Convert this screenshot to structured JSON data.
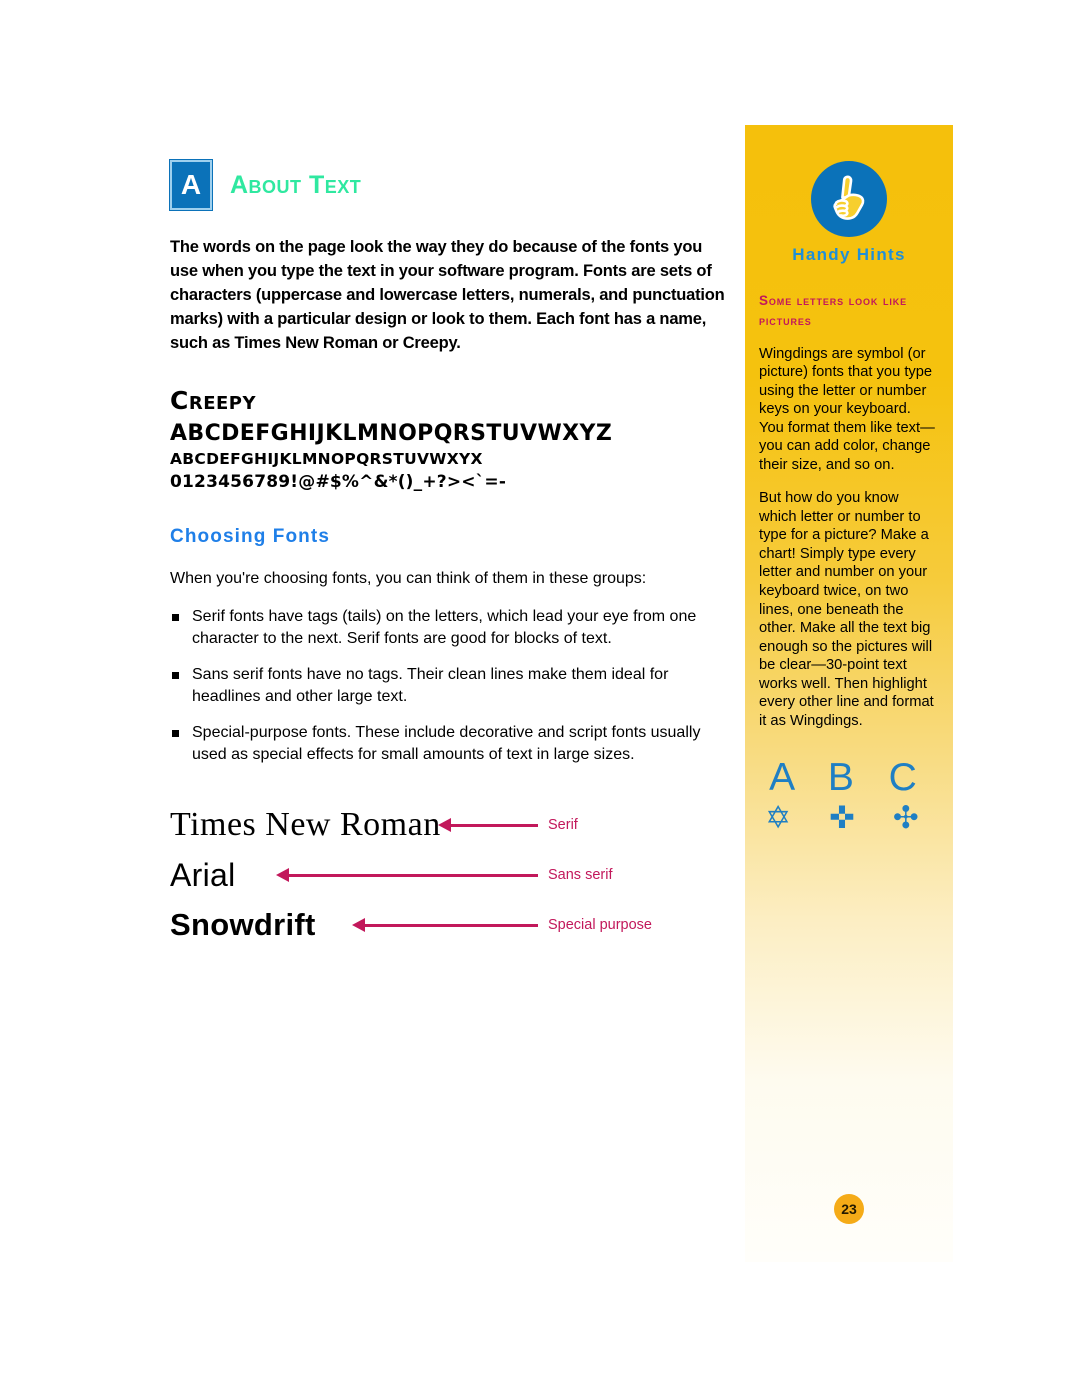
{
  "colors": {
    "badge_blue": "#0b72b9",
    "title_green": "#2fe8a0",
    "subheading_blue": "#1f7fe8",
    "arrow_crimson": "#c2185b",
    "sidebar_yellow": "#f5c00c",
    "hint_title_blue": "#1f8fd8",
    "wingdings_blue": "#1f7fc4",
    "page_badge_orange": "#f5ab17"
  },
  "main": {
    "badge_letter": "A",
    "section_title": "About Text",
    "intro": "The words on the page look the way they do because of the fonts you use when you type the text in your software program. Fonts are sets of characters (uppercase and lowercase letters, numerals, and punctuation marks) with a particular design or look to them. Each font has a name, such as Times New Roman or Creepy.",
    "specimen": {
      "name": "Creepy",
      "uppercase": "ABCDEFGHIJKLMNOPQRSTUVWXYZ",
      "smallcaps": "ABCDEFGHIJKLMNOPQRSTUVWXYX",
      "digits": "0123456789!@#$%^&*()_+?><`=-"
    },
    "subheading": "Choosing Fonts",
    "choosing_intro": "When you're choosing fonts, you can think of them in these groups:",
    "bullets": [
      "Serif fonts have tags (tails) on the letters, which lead your eye from one character to the next. Serif fonts are good for blocks of text.",
      "Sans serif fonts have no tags. Their clean lines make them ideal for headlines and other large text.",
      "Special-purpose fonts. These include decorative and script fonts usually used as special effects for small amounts of text in large sizes."
    ],
    "samples": [
      {
        "word": "Times New Roman",
        "label": "Serif"
      },
      {
        "word": "Arial",
        "label": "Sans serif"
      },
      {
        "word": "Snowdrift",
        "label": "Special purpose"
      }
    ]
  },
  "sidebar": {
    "icon_name": "pointing-hand-icon",
    "title": "Handy Hints",
    "hint_heading": "Some letters look like pictures",
    "paragraphs": [
      "Wingdings are symbol (or picture) fonts that you type using the letter or number keys on your keyboard. You format them like text—you can add color, change their size, and so on.",
      "But how do you know which letter or number to type for a picture? Make a chart! Simply type every letter and number on your keyboard twice, on two lines, one beneath the other. Make all the text big enough so the pictures will be clear—30-point text works well. Then highlight every other line and format it as Wingdings."
    ],
    "wingdings_letters": "A B C",
    "wingdings_symbols": "✡ ✜ ✣",
    "page_number": "23"
  }
}
